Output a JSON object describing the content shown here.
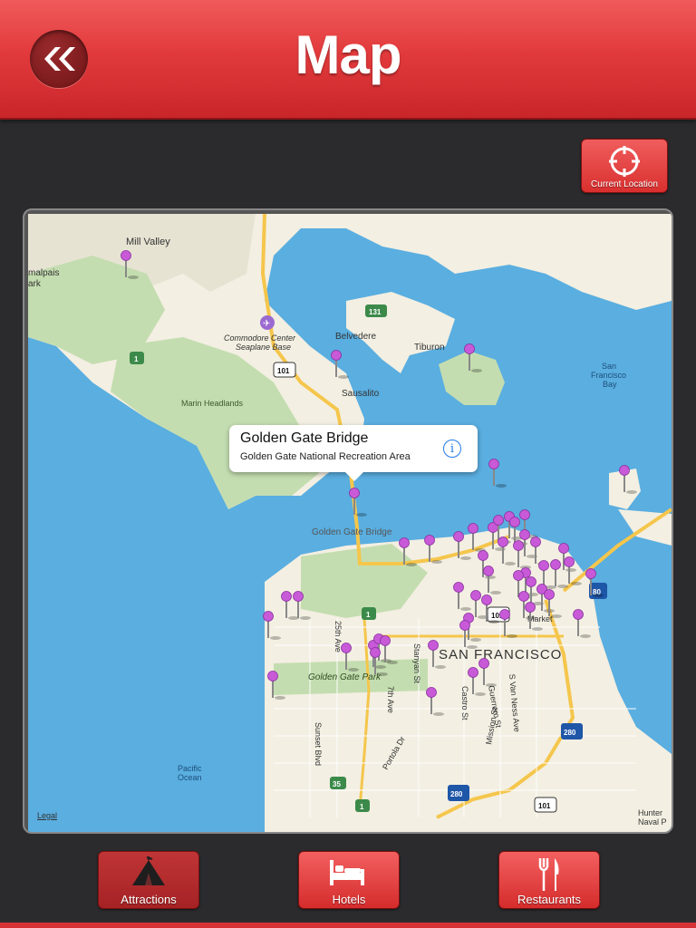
{
  "header": {
    "title": "Map",
    "back_icon": "double-chevron-left-icon"
  },
  "current_location": {
    "label": "Current Location",
    "icon": "crosshair-icon"
  },
  "map": {
    "labels": {
      "mill_valley": "Mill Valley",
      "tamalpais": "malpais",
      "park": "ark",
      "commodore": "Commodore Center",
      "seaplane": "Seaplane Base",
      "belvedere": "Belvedere",
      "tiburon": "Tiburon",
      "sausalito": "Sausalito",
      "marin_headlands": "Marin Headlands",
      "sf_bay_1": "San",
      "sf_bay_2": "Francisco",
      "sf_bay_3": "Bay",
      "golden_gate_bridge": "Golden Gate Bridge",
      "san_francisco": "SAN FRANCISCO",
      "golden_gate_park": "Golden Gate Park",
      "pacific_1": "Pacific",
      "pacific_2": "Ocean",
      "sunset_blvd": "Sunset Blvd",
      "hunters_1": "Hunter",
      "hunters_2": "Naval P",
      "ave25": "25th Ave",
      "stanyan": "Stanyan St",
      "castro": "Castro St",
      "guerrero": "Guerrero St",
      "van_ness": "S Van Ness Ave",
      "mission": "Mission St",
      "portola": "Portola Dr",
      "ave7": "7th Ave",
      "market": "Market",
      "legal": "Legal"
    },
    "shields": {
      "r1a": "1",
      "r131": "131",
      "r101a": "101",
      "r1b": "1",
      "r10": "101",
      "r80": "80",
      "r280a": "280",
      "r280b": "280",
      "r35": "35",
      "r1c": "1",
      "r101b": "101"
    },
    "callout": {
      "title": "Golden Gate Bridge",
      "subtitle": "Golden Gate National Recreation Area",
      "info_icon": "i"
    },
    "pin_color": "#c85ad8"
  },
  "tabs": [
    {
      "label": "Attractions",
      "icon": "tent-icon",
      "active": true
    },
    {
      "label": "Hotels",
      "icon": "bed-icon",
      "active": false
    },
    {
      "label": "Restaurants",
      "icon": "fork-knife-icon",
      "active": false
    }
  ],
  "colors": {
    "accent": "#e23a3c",
    "background": "#2b2b2d",
    "water": "#5aaee0",
    "land": "#f3efe2",
    "park": "#c4ddb0"
  }
}
